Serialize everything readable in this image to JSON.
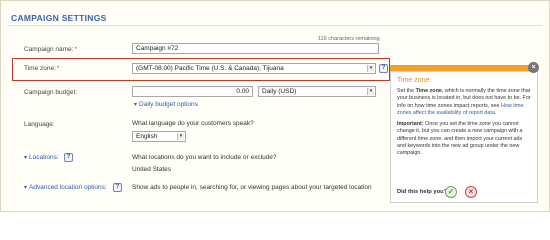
{
  "section": {
    "title": "CAMPAIGN SETTINGS"
  },
  "campaign_name": {
    "label": "Campaign name:",
    "required_mark": "*",
    "value": "Campaign #72",
    "chars_remaining": "116 characters remaining"
  },
  "time_zone": {
    "label": "Time zone:",
    "required_mark": "*",
    "value": "(GMT-08:00) Pacific Time (U.S. & Canada); Tijuana",
    "help": "?"
  },
  "budget": {
    "label": "Campaign budget:",
    "amount": "0.00",
    "period": "Daily (USD)",
    "options_link": "Daily budget options"
  },
  "language": {
    "label": "Language:",
    "question": "What language do your customers speak?",
    "value": "English"
  },
  "locations": {
    "label": "Locations:",
    "help": "?",
    "question": "What locations do you want to include or exclude?",
    "value": "United States"
  },
  "advanced_locations": {
    "label": "Advanced location options:",
    "help": "?",
    "description": "Show ads to people in, searching for, or viewing pages about your targeted location"
  },
  "callout": {
    "title": "Time zone",
    "p1_pre": "Set the ",
    "p1_bold": "Time zone",
    "p1_post": ", which is normally the time zone that your business is located in, but does not have to be. For info on how time zones impact reports, see ",
    "p1_link": "How time zones affect the availability of report data",
    "p1_end": ".",
    "p2_bold": "Important:",
    "p2_text": " Once you set the time zone you cannot change it, but you can create a new campaign with a different time zone, and then import your current ads and keywords into the new ad group under the new campaign.",
    "helpful": "Did this help you?",
    "close": "×",
    "yes": "✓",
    "no": "×"
  },
  "icons": {
    "chevron": "chevron-down-icon",
    "help": "question-icon",
    "close": "close-icon"
  },
  "colors": {
    "title": "#3a63a8",
    "highlight": "#c0392b",
    "callout_accent": "#f1a12b",
    "link": "#2f5bb0"
  }
}
